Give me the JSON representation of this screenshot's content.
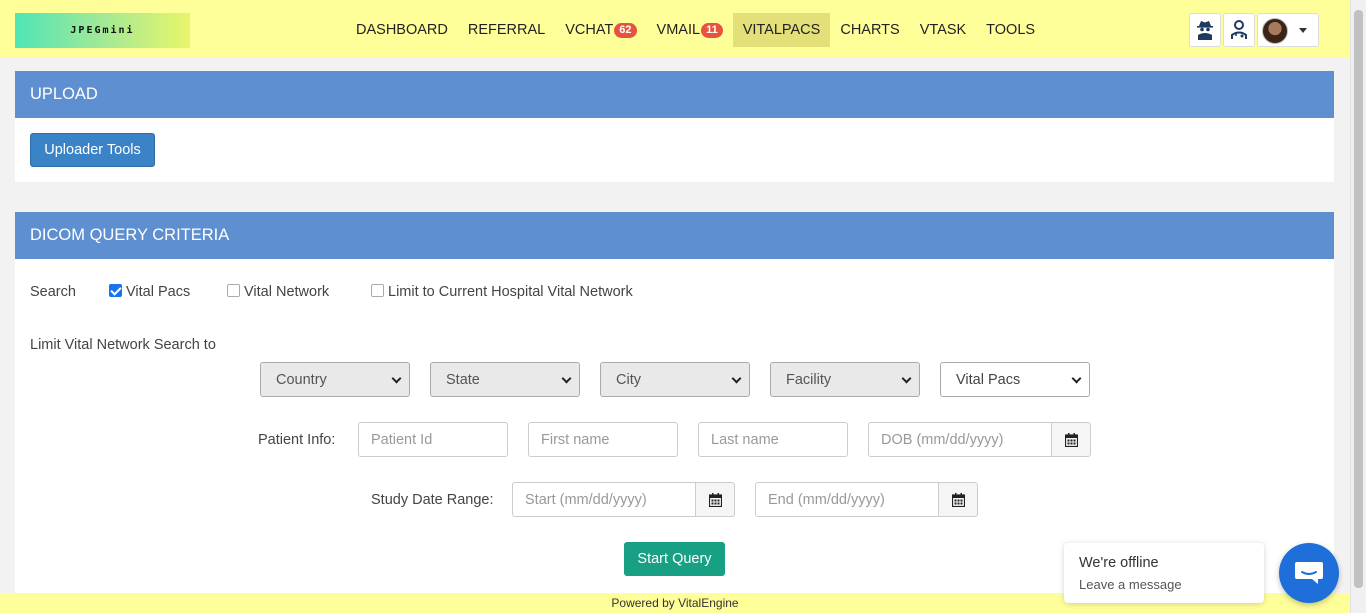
{
  "header": {
    "logo_text": "JPEGmini",
    "nav": [
      {
        "label": "DASHBOARD",
        "badge": null,
        "active": false
      },
      {
        "label": "REFERRAL",
        "badge": null,
        "active": false
      },
      {
        "label": "VCHAT",
        "badge": "62",
        "active": false
      },
      {
        "label": "VMAIL",
        "badge": "11",
        "active": false
      },
      {
        "label": "VITALPACS",
        "badge": null,
        "active": true
      },
      {
        "label": "CHARTS",
        "badge": null,
        "active": false
      },
      {
        "label": "VTASK",
        "badge": null,
        "active": false
      },
      {
        "label": "TOOLS",
        "badge": null,
        "active": false
      }
    ],
    "icons": [
      "spy-agent-icon",
      "doctor-icon"
    ]
  },
  "upload": {
    "title": "UPLOAD",
    "uploader_button": "Uploader Tools"
  },
  "dicom": {
    "title": "DICOM QUERY CRITERIA",
    "search_label": "Search",
    "checkboxes": [
      {
        "label": "Vital Pacs",
        "checked": true
      },
      {
        "label": "Vital Network",
        "checked": false
      },
      {
        "label": "Limit to Current Hospital Vital Network",
        "checked": false
      }
    ],
    "limit_label": "Limit Vital Network Search to",
    "selects": {
      "country": "Country",
      "state": "State",
      "city": "City",
      "facility": "Facility",
      "source": "Vital Pacs"
    },
    "patient_info_label": "Patient Info:",
    "patient_id_placeholder": "Patient Id",
    "first_name_placeholder": "First name",
    "last_name_placeholder": "Last name",
    "dob_placeholder": "DOB (mm/dd/yyyy)",
    "study_date_label": "Study Date Range:",
    "start_placeholder": "Start (mm/dd/yyyy)",
    "end_placeholder": "End (mm/dd/yyyy)",
    "start_query_button": "Start Query"
  },
  "footer": {
    "text": "Powered by VitalEngine"
  },
  "chat": {
    "title": "We're offline",
    "subtitle": "Leave a message"
  },
  "colors": {
    "header_bg": "#ffff99",
    "panel_head": "#5d8fd1",
    "primary_button": "#3a83c6",
    "query_button": "#18a085",
    "badge": "#e8533e",
    "chat_button": "#1e6fd9"
  }
}
